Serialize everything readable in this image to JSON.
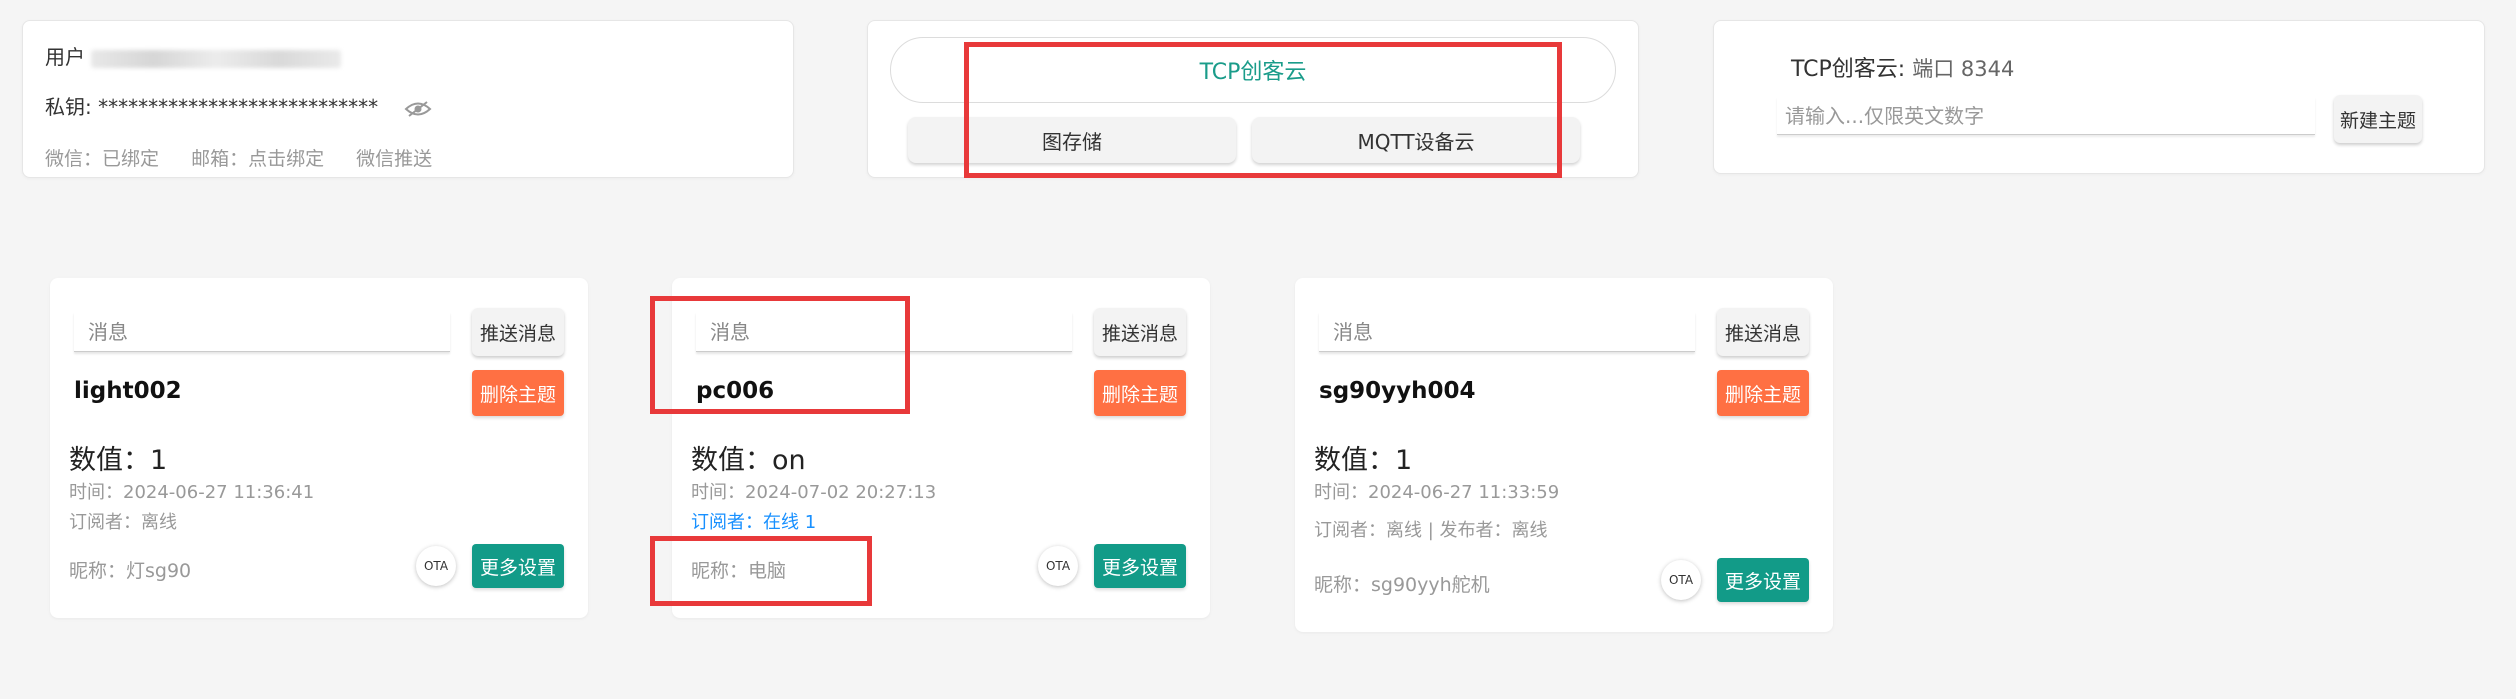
{
  "account": {
    "user_label": "用户",
    "key_label": "私钥:",
    "key_value": "****************************",
    "wechat_status": "微信：已绑定",
    "email_status": "邮箱：点击绑定",
    "wechat_push": "微信推送",
    "eye_icon": "eye-slash-icon"
  },
  "platforms": {
    "selected": "TCP创客云",
    "image_storage": "图存储",
    "mqtt": "MQTT设备云"
  },
  "new_topic": {
    "platform_label": "TCP创客云:",
    "port_text": "端口 8344",
    "input_placeholder": "请输入...仅限英文数字",
    "button_label": "新建主题"
  },
  "devices": [
    {
      "message_placeholder": "消息",
      "push_label": "推送消息",
      "topic": "light002",
      "delete_label": "删除主题",
      "value_text": "数值：1",
      "time_text": "时间：2024-06-27 11:36:41",
      "subscriber_text": "订阅者：离线",
      "nickname_text": "昵称：灯sg90",
      "ota_label": "OTA",
      "more_label": "更多设置"
    },
    {
      "message_placeholder": "消息",
      "push_label": "推送消息",
      "topic": "pc006",
      "delete_label": "删除主题",
      "value_text": "数值：on",
      "time_text": "时间：2024-07-02 20:27:13",
      "subscriber_text": "订阅者：在线 1",
      "nickname_text": "昵称：电脑",
      "ota_label": "OTA",
      "more_label": "更多设置"
    },
    {
      "message_placeholder": "消息",
      "push_label": "推送消息",
      "topic": "sg90yyh004",
      "delete_label": "删除主题",
      "value_text": "数值：1",
      "time_text": "时间：2024-06-27 11:33:59",
      "subscriber_text": "订阅者：离线 | 发布者：离线",
      "nickname_text": "昵称：sg90yyh舵机",
      "ota_label": "OTA",
      "more_label": "更多设置"
    }
  ],
  "colors": {
    "accent_teal": "#129b88",
    "delete_orange": "#ff7043",
    "online_blue": "#1890ff",
    "highlight_red": "#e8393a"
  }
}
